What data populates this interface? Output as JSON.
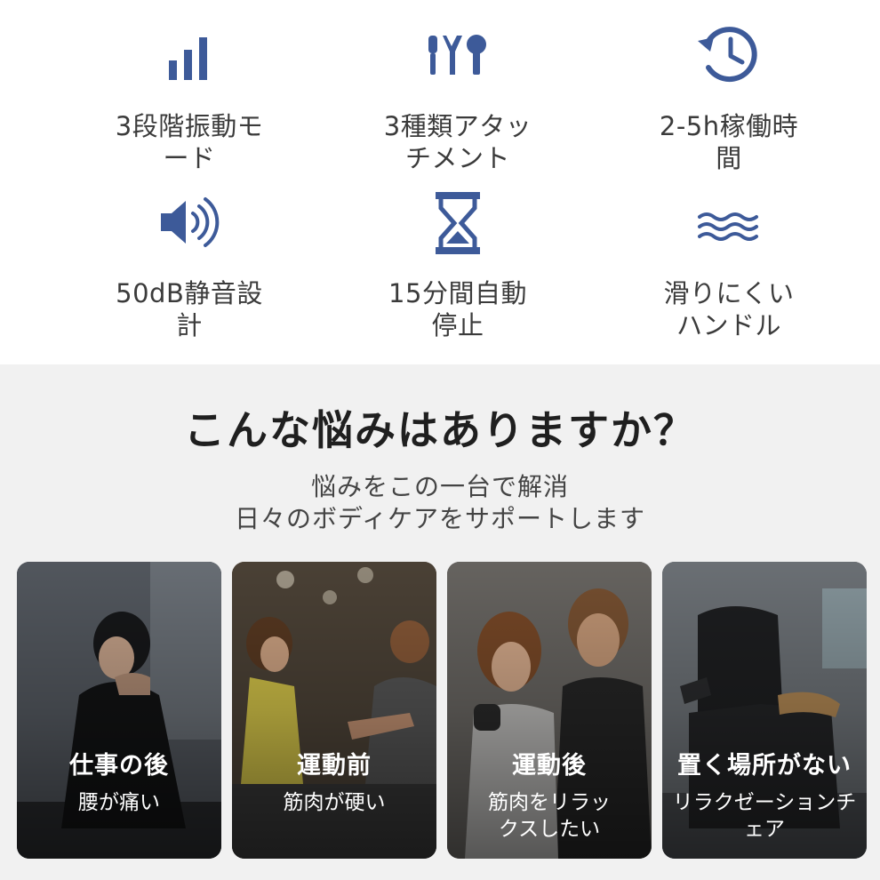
{
  "colors": {
    "icon_blue": "#3d5a99",
    "section_bg": "#f1f1f1",
    "title_text": "#1f1f1f"
  },
  "features": [
    {
      "icon": "signal-bars-icon",
      "label": "3段階振動モード"
    },
    {
      "icon": "attachments-icon",
      "label": "3種類アタッチメント"
    },
    {
      "icon": "clock-history-icon",
      "label": "2-5h稼働時間"
    },
    {
      "icon": "speaker-icon",
      "label": "50dB静音設計"
    },
    {
      "icon": "hourglass-icon",
      "label": "15分間自動停止"
    },
    {
      "icon": "waves-icon",
      "label": "滑りにくいハンドル"
    }
  ],
  "problems": {
    "title": "こんな悩みはありますか？",
    "subtitle_line1": "悩みをこの一台で解消",
    "subtitle_line2": "日々のボディケアをサポートします",
    "cards": [
      {
        "title": "仕事の後",
        "text": "腰が痛い",
        "photo": "office-worker-neck-pain-photo"
      },
      {
        "title": "運動前",
        "text": "筋肉が硬い",
        "photo": "gym-pushup-couple-photo"
      },
      {
        "title": "運動後",
        "text": "筋肉をリラックスしたい",
        "photo": "fitness-couple-photo"
      },
      {
        "title": "置く場所がない",
        "text": "リラクゼーションチェア",
        "photo": "massage-chair-photo"
      }
    ]
  }
}
